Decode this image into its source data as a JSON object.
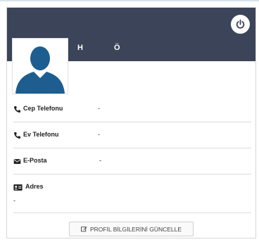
{
  "profile": {
    "first_name": "H",
    "last_name": "Ö"
  },
  "contact": {
    "mobile": {
      "label": "Cep Telefonu",
      "value": "-"
    },
    "home": {
      "label": "Ev Telefonu",
      "value": "-"
    },
    "email": {
      "label": "E-Posta",
      "value": "-"
    },
    "address": {
      "label": "Adres",
      "value": "-"
    }
  },
  "actions": {
    "update_label": "PROFİL BİLGİLERİNİ GÜNCELLE"
  },
  "icons": {
    "power": "power-icon",
    "mobile": "phone-icon",
    "home": "phone-icon",
    "email": "envelope-icon",
    "address": "address-card-icon",
    "update": "edit-icon"
  },
  "colors": {
    "header": "#3b4458",
    "avatar": "#1e5d8f"
  }
}
